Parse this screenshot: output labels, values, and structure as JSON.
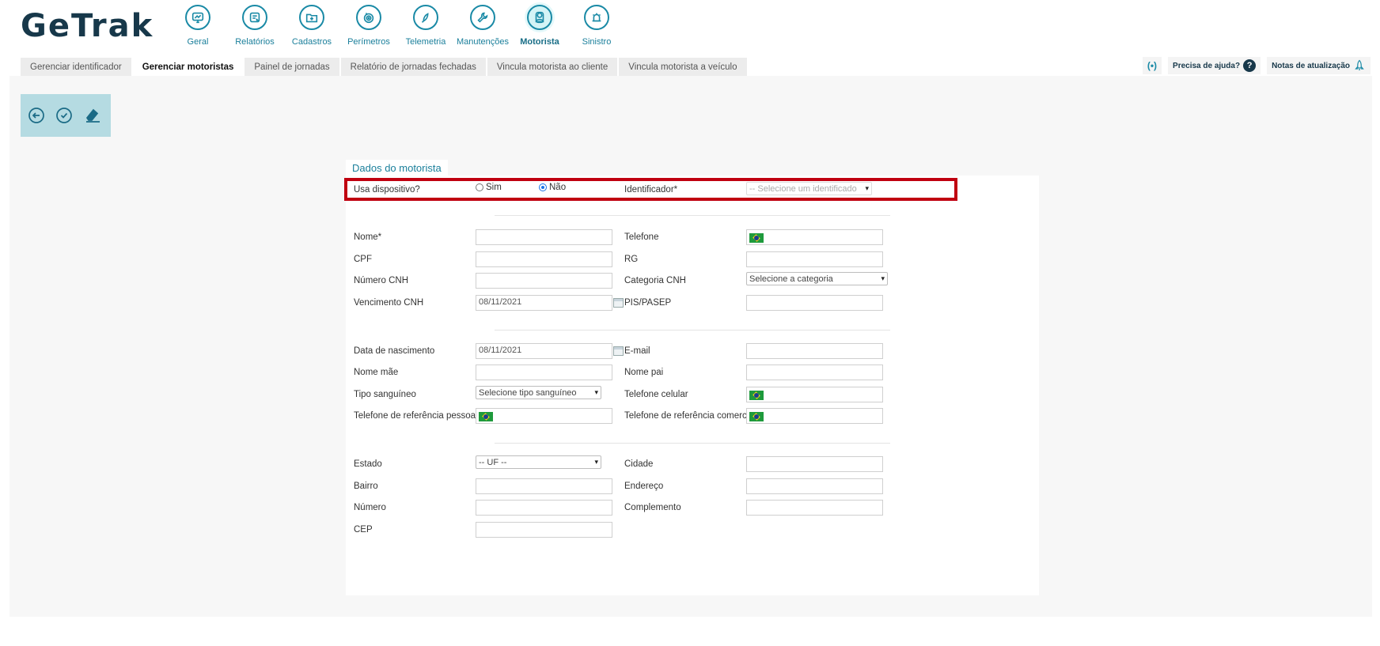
{
  "app": {
    "logo": "GeTrak"
  },
  "nav": [
    {
      "label": "Geral",
      "icon": "monitor-chart-icon",
      "active": false
    },
    {
      "label": "Relatórios",
      "icon": "report-doc-icon",
      "active": false
    },
    {
      "label": "Cadastros",
      "icon": "folder-plus-icon",
      "active": false
    },
    {
      "label": "Perímetros",
      "icon": "target-icon",
      "active": false
    },
    {
      "label": "Telemetria",
      "icon": "compass-icon",
      "active": false
    },
    {
      "label": "Manutenções",
      "icon": "wrench-icon",
      "active": false
    },
    {
      "label": "Motorista",
      "icon": "driver-icon",
      "active": true
    },
    {
      "label": "Sinistro",
      "icon": "alarm-icon",
      "active": false
    }
  ],
  "tabs": [
    {
      "label": "Gerenciar identificador",
      "active": false
    },
    {
      "label": "Gerenciar motoristas",
      "active": true
    },
    {
      "label": "Painel de jornadas",
      "active": false
    },
    {
      "label": "Relatório de jornadas fechadas",
      "active": false
    },
    {
      "label": "Vincula motorista ao cliente",
      "active": false
    },
    {
      "label": "Vincula motorista a veículo",
      "active": false
    }
  ],
  "topright": {
    "help": "Precisa de ajuda?",
    "help_icon": "?",
    "notes": "Notas de atualização",
    "signal_icon": "(•)"
  },
  "toolbar": {
    "back": "back-icon",
    "confirm": "check-icon",
    "clear": "eraser-icon"
  },
  "form": {
    "title": "Dados do motorista",
    "uses_device_label": "Usa dispositivo?",
    "opt_sim": "Sim",
    "opt_nao": "Não",
    "identificador_label": "Identificador*",
    "identificador_placeholder": "-- Selecione um identificador --",
    "nome": "Nome*",
    "telefone": "Telefone",
    "cpf": "CPF",
    "rg": "RG",
    "numero_cnh": "Número CNH",
    "categoria_cnh": "Categoria CNH",
    "categoria_placeholder": "Selecione a categoria",
    "vencimento_cnh": "Vencimento CNH",
    "vencimento_value": "08/11/2021",
    "pis": "PIS/PASEP",
    "data_nasc": "Data de nascimento",
    "data_nasc_value": "08/11/2021",
    "email": "E-mail",
    "nome_mae": "Nome mãe",
    "nome_pai": "Nome pai",
    "tipo_sangue": "Tipo sanguíneo",
    "tipo_sangue_placeholder": "Selecione tipo sanguíneo",
    "tel_celular": "Telefone celular",
    "tel_ref_pessoal": "Telefone de referência pessoal",
    "tel_ref_comercial": "Telefone de referência comercial",
    "estado": "Estado",
    "estado_placeholder": "-- UF --",
    "cidade": "Cidade",
    "bairro": "Bairro",
    "endereco": "Endereço",
    "numero": "Número",
    "complemento": "Complemento",
    "cep": "CEP"
  },
  "colors": {
    "accent": "#1a8aa6",
    "highlight": "#c00010",
    "toolbar_bg": "#b5dbe2"
  }
}
